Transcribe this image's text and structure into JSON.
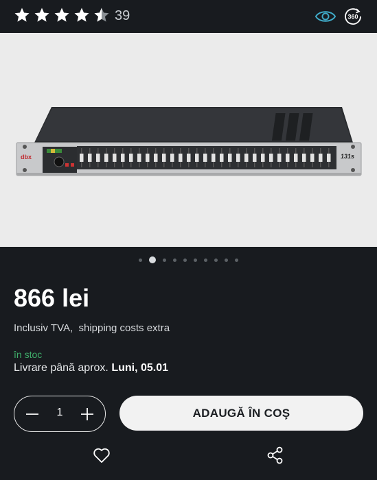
{
  "rating": {
    "value": 4.5,
    "max": 5,
    "count": "39",
    "star_color": "#ffffff",
    "empty_star_color": "#8a8f94"
  },
  "header_icons": {
    "view": "eye-icon",
    "view360": "360-view-icon",
    "view360_label": "360",
    "eye_color": "#3fa9c6"
  },
  "product_image": {
    "brand_logo": "dbx",
    "model_label": "131s",
    "alt": "dbx 131s graphic equalizer"
  },
  "gallery": {
    "total": 10,
    "active_index": 1
  },
  "product": {
    "price": "866 lei",
    "tax_note": "Inclusiv TVA,  shipping costs extra",
    "stock": "în stoc",
    "delivery_label": "Livrare până aprox. ",
    "delivery_date": "Luni, 05.01",
    "stock_color": "#3fae6a"
  },
  "cart": {
    "quantity": "1",
    "add_label": "ADAUGĂ ÎN COŞ"
  },
  "actions": {
    "wishlist": "heart-icon",
    "share": "share-icon"
  }
}
